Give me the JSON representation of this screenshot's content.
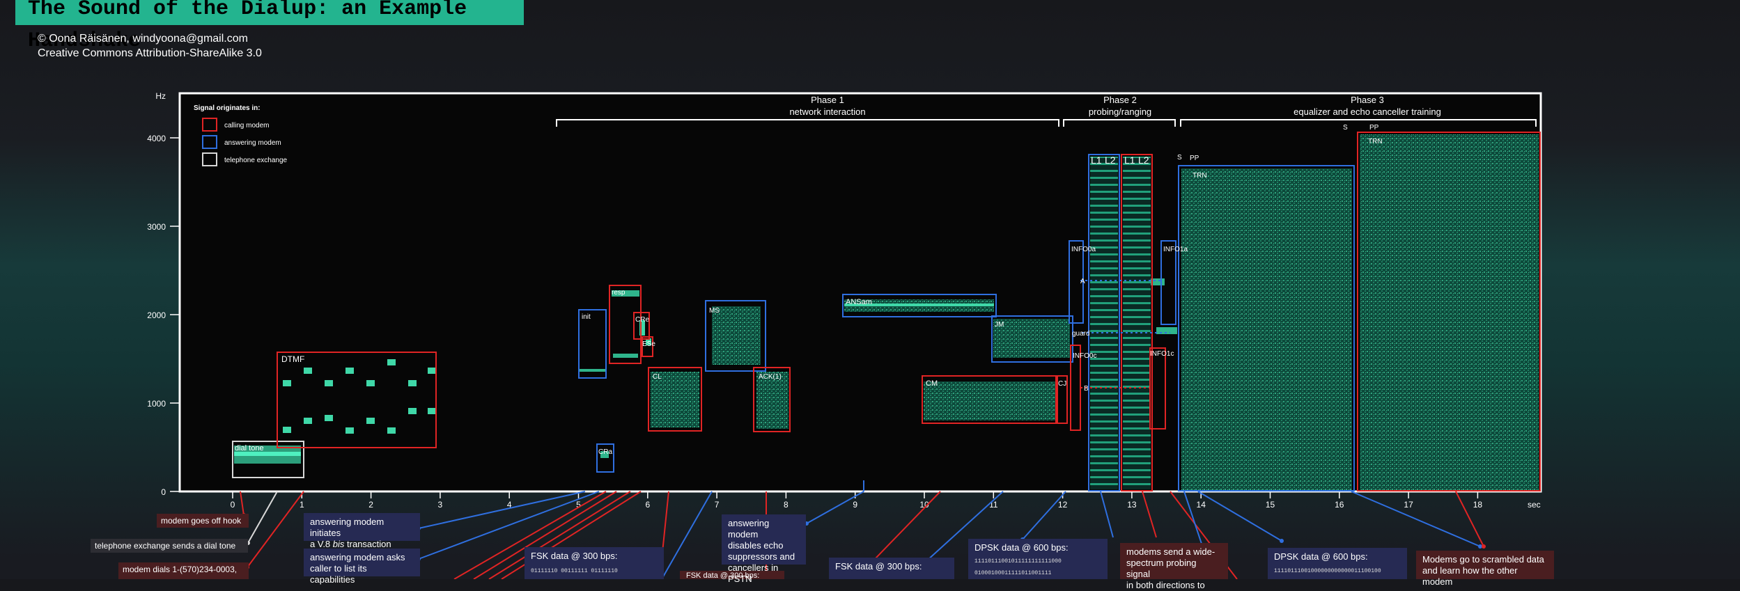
{
  "title": "The Sound of the Dialup: an Example Handshake",
  "credit": {
    "line1": "© Oona Räisänen, windyoona@gmail.com",
    "line2": "Creative Commons Attribution-ShareAlike 3.0"
  },
  "axes": {
    "y_unit": "Hz",
    "y_ticks": [
      "0",
      "1000",
      "2000",
      "3000",
      "4000"
    ],
    "x_unit": "sec",
    "x_ticks": [
      "0",
      "1",
      "2",
      "3",
      "4",
      "5",
      "6",
      "7",
      "8",
      "9",
      "10",
      "11",
      "12",
      "13",
      "14",
      "15",
      "16",
      "17",
      "18"
    ]
  },
  "legend": {
    "title": "Signal originates in:",
    "items": [
      {
        "label": "calling modem",
        "color": "#e02424"
      },
      {
        "label": "answering modem",
        "color": "#2f6fe0"
      },
      {
        "label": "telephone exchange",
        "color": "#d8d8d8"
      }
    ]
  },
  "phases": [
    {
      "name": "Phase 1",
      "desc": "network interaction"
    },
    {
      "name": "Phase 2",
      "desc": "probing/ranging"
    },
    {
      "name": "Phase 3",
      "desc": "equalizer and echo canceller training"
    }
  ],
  "signal_labels": {
    "dial_tone": "dial tone",
    "dtmf": "DTMF",
    "init": "init",
    "resp": "resp",
    "cr_e": "CRe",
    "es_e": "ESe",
    "cr_a": "CRa",
    "cl": "CL",
    "ms": "MS",
    "ack": "ACK(1)",
    "ansam": "ANSam",
    "jm": "JM",
    "cm": "CM",
    "cj": "CJ",
    "info0a": "INFO0a",
    "info1a": "INFO1a",
    "info0c": "INFO0c",
    "info1c": "INFO1c",
    "a": "A",
    "b": "B",
    "guard": "guard",
    "l1a": "L1",
    "l2a": "L2",
    "l1c": "L1",
    "l2c": "L2",
    "s_a": "S",
    "pp_a": "PP",
    "trn_a": "TRN",
    "s_c": "S",
    "pp_c": "PP",
    "trn_c": "TRN"
  },
  "annotations": {
    "off_hook": "modem goes off hook",
    "dial_tone_sent": "telephone exchange sends a dial tone",
    "dials": "modem dials 1-(570)234-0003,",
    "v8bis_1": "answering modem initiates",
    "v8bis_2a": "a V.8 ",
    "v8bis_2b": "bis",
    "v8bis_2c": " transaction",
    "caps_1": "answering modem asks",
    "caps_2": "caller to list its capabilities",
    "fsk1": "FSK data @ 300 bps:",
    "fsk1_bits": "01111110 00111111 01111110",
    "fsk2": "FSK data @ 300 bps:",
    "fsk3": "FSK data @ 300 bps:",
    "echo_1": "answering modem",
    "echo_2": "disables echo",
    "echo_3": "suppressors and",
    "echo_4": "cancellers in PSTN",
    "dpsk1": "DPSK data @ 600 bps:",
    "dpsk1_bits1": "11110111001011111111111000",
    "dpsk1_bits2": "01000100011111011001111",
    "probe_1": "modems send a wide-",
    "probe_2": "spectrum probing signal",
    "probe_3": "in both directions to",
    "dpsk2": "DPSK data @ 600 bps:",
    "dpsk2_bits": "11110111001000000000000011100100",
    "scr_1": "Modems go to scrambled data",
    "scr_2": "and learn how the other modem"
  },
  "colors": {
    "calling": "#e02424",
    "answering": "#2f6fe0",
    "exchange": "#d8d8d8",
    "title_bg": "#23b48f"
  }
}
